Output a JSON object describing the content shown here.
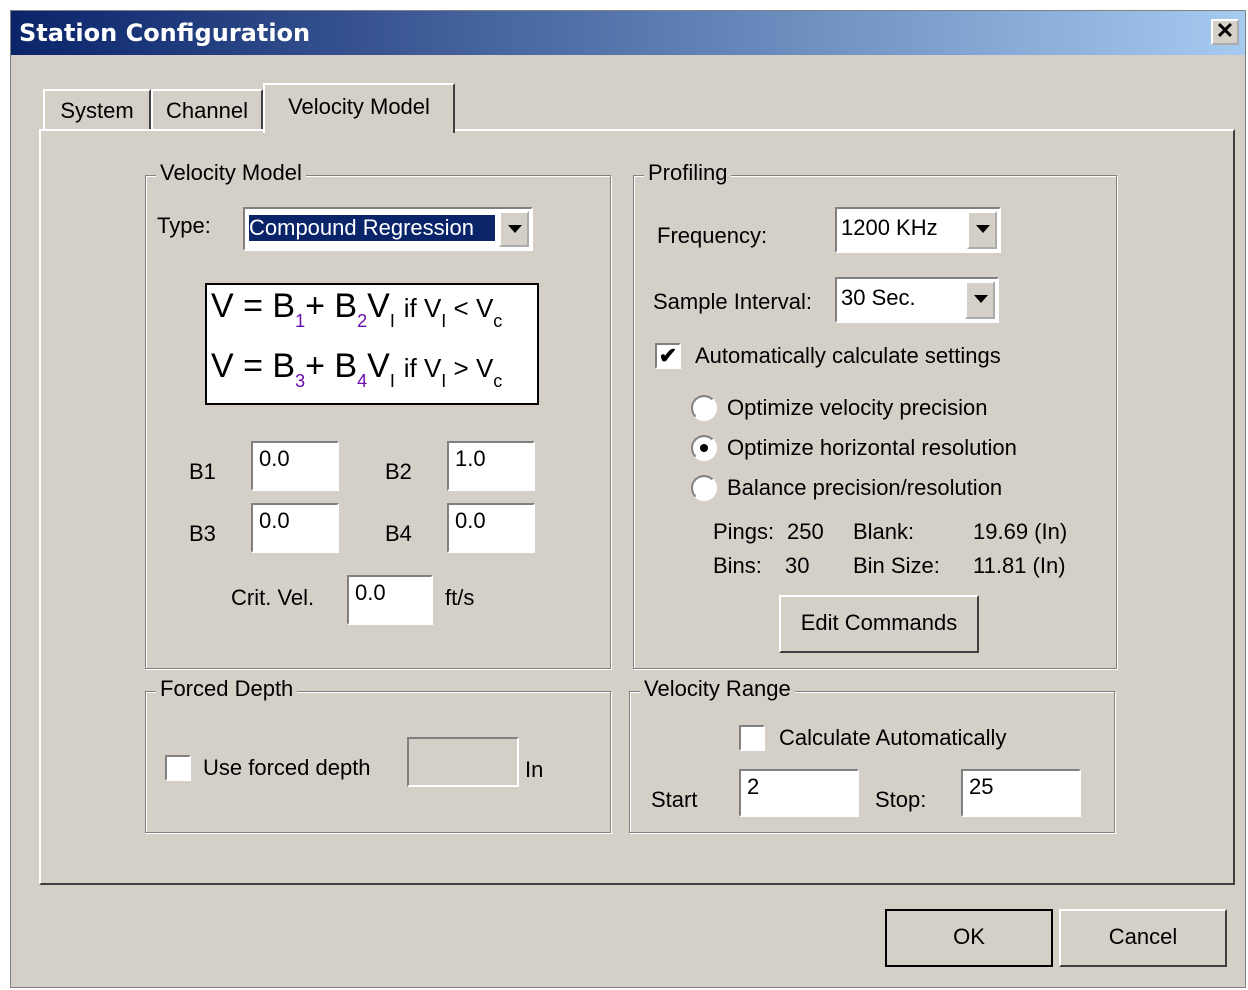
{
  "window": {
    "title": "Station Configuration",
    "close_glyph": "✕"
  },
  "tabs": [
    {
      "label": "System"
    },
    {
      "label": "Channel"
    },
    {
      "label": "Velocity Model"
    }
  ],
  "velocity_model": {
    "group_label": "Velocity Model",
    "type_label": "Type:",
    "type_value": "Compound Regression",
    "formula": {
      "line1": {
        "lhs": "V = B",
        "s1": "1",
        "mid": "+ B",
        "s2": "2",
        "v": "V",
        "sv": "I",
        "cond": "if V",
        "scond": "I",
        "op": " < V",
        "sc": "c"
      },
      "line2": {
        "lhs": "V = B",
        "s1": "3",
        "mid": "+ B",
        "s2": "4",
        "v": "V",
        "sv": "I",
        "cond": "if V",
        "scond": "I",
        "op": " > V",
        "sc": "c"
      }
    },
    "b1_label": "B1",
    "b1_value": "0.0",
    "b2_label": "B2",
    "b2_value": "1.0",
    "b3_label": "B3",
    "b3_value": "0.0",
    "b4_label": "B4",
    "b4_value": "0.0",
    "crit_label": "Crit. Vel.",
    "crit_value": "0.0",
    "crit_unit": "ft/s"
  },
  "profiling": {
    "group_label": "Profiling",
    "frequency_label": "Frequency:",
    "frequency_value": "1200 KHz",
    "sample_label": "Sample Interval:",
    "sample_value": "30 Sec.",
    "auto_label": "Automatically calculate settings",
    "auto_checked": true,
    "options": [
      {
        "label": "Optimize velocity precision",
        "selected": false
      },
      {
        "label": "Optimize horizontal resolution",
        "selected": true
      },
      {
        "label": "Balance precision/resolution",
        "selected": false
      }
    ],
    "pings_label": "Pings:",
    "pings_value": "250",
    "blank_label": "Blank:",
    "blank_value": "19.69 (In)",
    "bins_label": "Bins:",
    "bins_value": "30",
    "binsize_label": "Bin Size:",
    "binsize_value": "11.81 (In)",
    "edit_button": "Edit Commands"
  },
  "forced_depth": {
    "group_label": "Forced Depth",
    "checkbox_label": "Use forced depth",
    "value": "",
    "unit": "In"
  },
  "velocity_range": {
    "group_label": "Velocity Range",
    "auto_label": "Calculate Automatically",
    "start_label": "Start",
    "start_value": "2",
    "stop_label": "Stop:",
    "stop_value": "25"
  },
  "footer": {
    "ok": "OK",
    "cancel": "Cancel"
  }
}
